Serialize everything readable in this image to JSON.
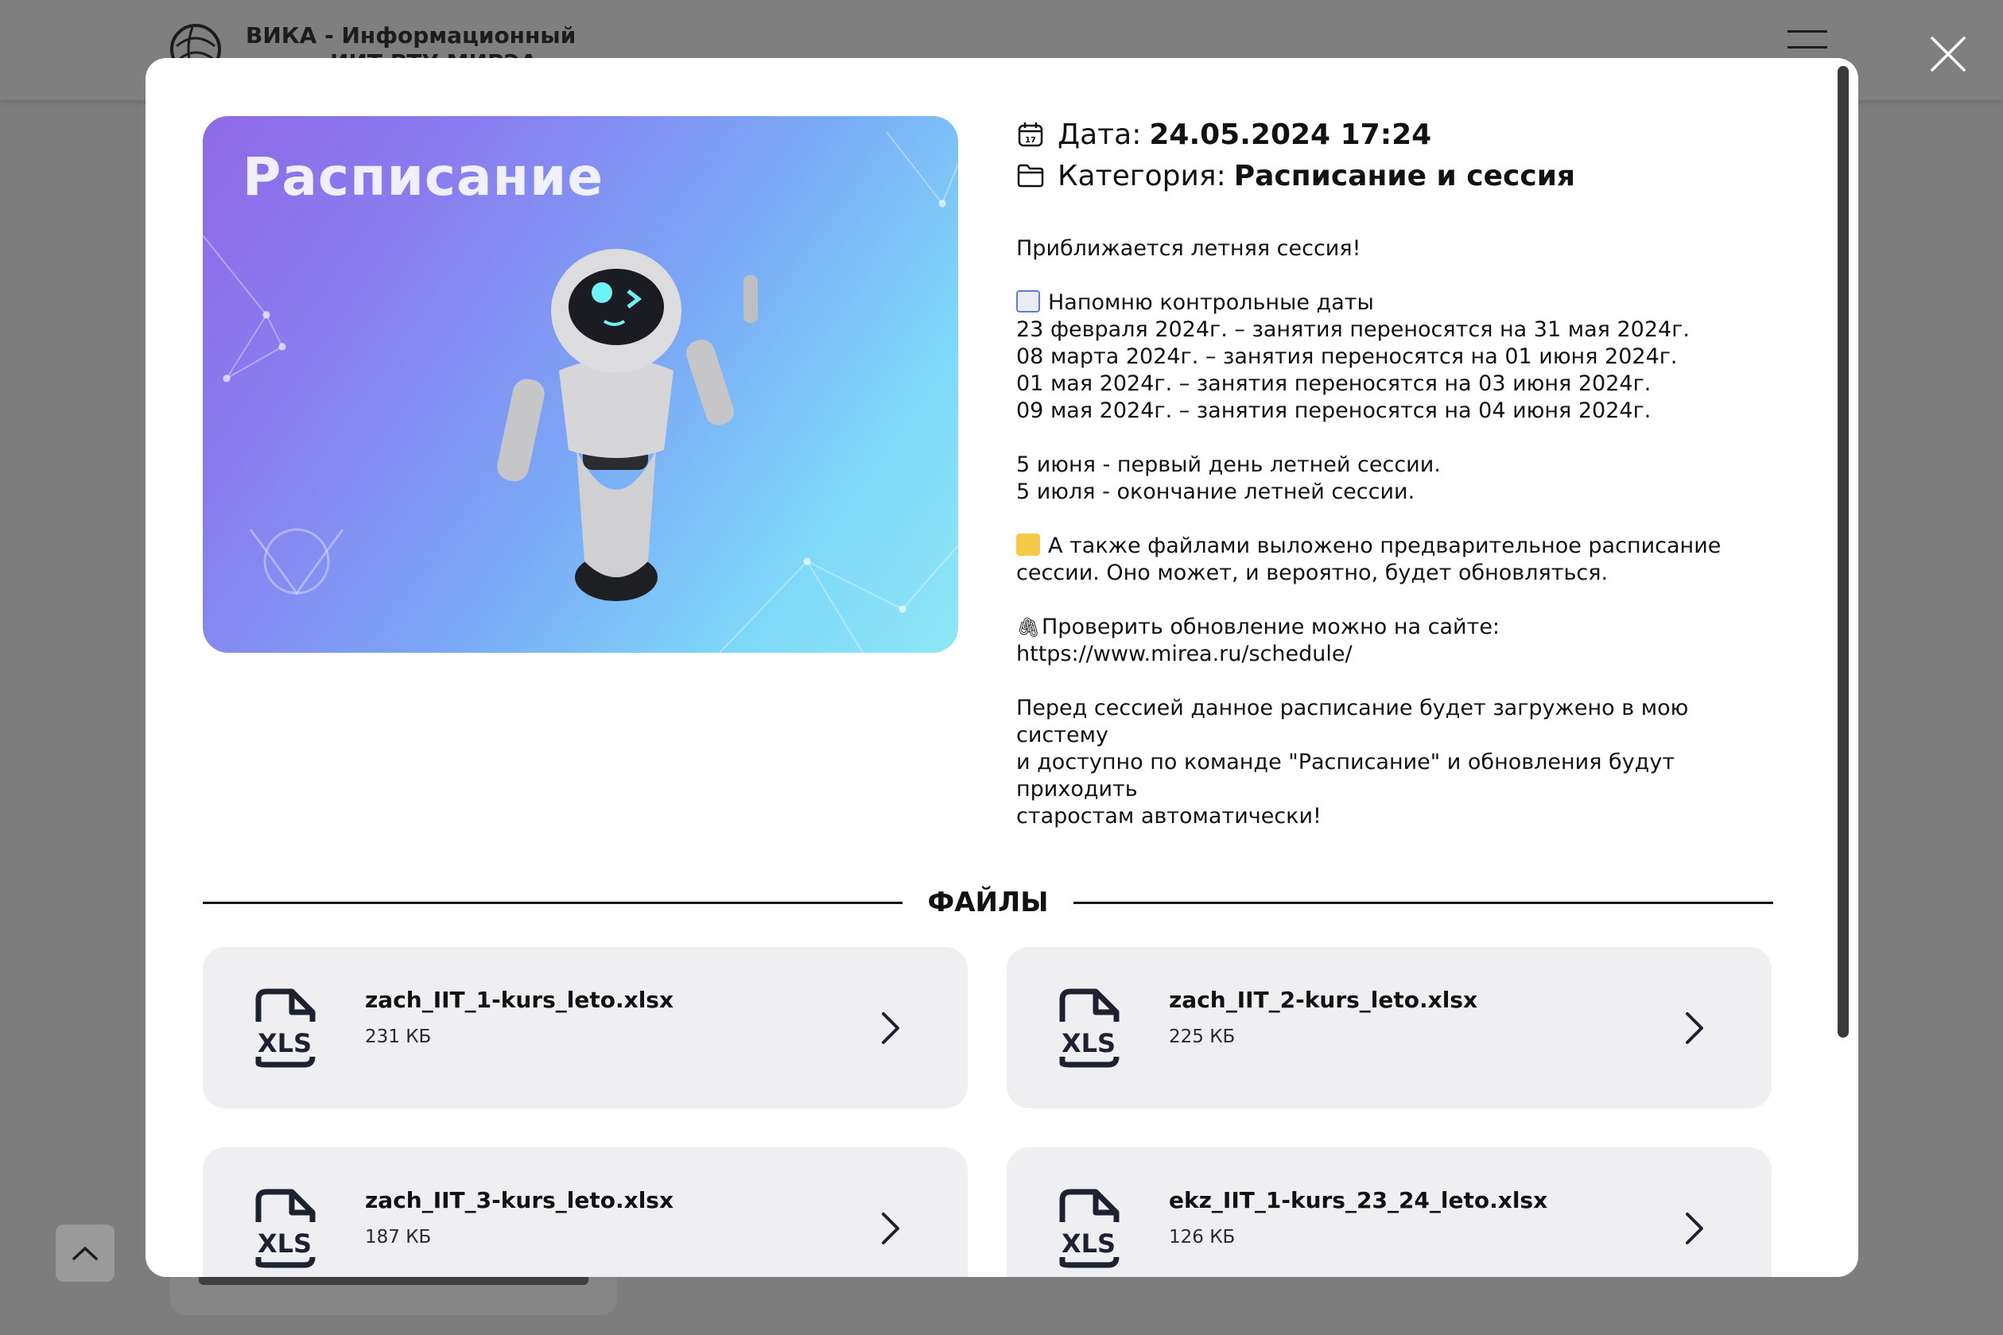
{
  "background": {
    "title_line1": "ВИКА - Информационный",
    "title_line2": "ИИТ РТУ МИРЭА"
  },
  "modal": {
    "hero_title": "Расписание",
    "date_label": "Дата:",
    "date_value": "24.05.2024 17:24",
    "category_label": "Категория:",
    "category_value": "Расписание и сессия",
    "paragraphs": {
      "p1": "Приближается летняя сессия!",
      "p2_head": "Напомню контрольные даты",
      "p2_l1": "23 февраля 2024г. – занятия переносятся на 31 мая 2024г.",
      "p2_l2": "08 марта 2024г. – занятия переносятся на 01 июня 2024г.",
      "p2_l3": "01 мая 2024г. – занятия переносятся на 03 июня 2024г.",
      "p2_l4": "09 мая 2024г. – занятия переносятся на 04 июня 2024г.",
      "p3_l1": "5 июня - первый день летней сессии.",
      "p3_l2": "5 июля - окончание летней сессии.",
      "p4_l1": "А также файлами выложено предварительное расписание",
      "p4_l2": "сессии. Оно может, и вероятно, будет обновляться.",
      "p5_l1": "Проверить обновление можно на сайте:",
      "p5_link": "https://www.mirea.ru/schedule/",
      "p6_l1": "Перед сессией данное расписание будет загружено в мою систему",
      "p6_l2": "и доступно по команде \"Расписание\" и обновления будут приходить",
      "p6_l3": "старостам автоматически!"
    },
    "files_title": "ФАЙЛЫ",
    "files": [
      {
        "name": "zach_IIT_1-kurs_leto.xlsx",
        "size": "231 КБ",
        "icon": "xls-file-icon"
      },
      {
        "name": "zach_IIT_2-kurs_leto.xlsx",
        "size": "225 КБ",
        "icon": "xls-file-icon"
      },
      {
        "name": "zach_IIT_3-kurs_leto.xlsx",
        "size": "187 КБ",
        "icon": "xls-file-icon"
      },
      {
        "name": "ekz_IIT_1-kurs_23_24_leto.xlsx",
        "size": "126 КБ",
        "icon": "xls-file-icon"
      }
    ]
  },
  "colors": {
    "overlay": "#7d7d7d",
    "card": "#efeff1",
    "text": "#121212"
  }
}
